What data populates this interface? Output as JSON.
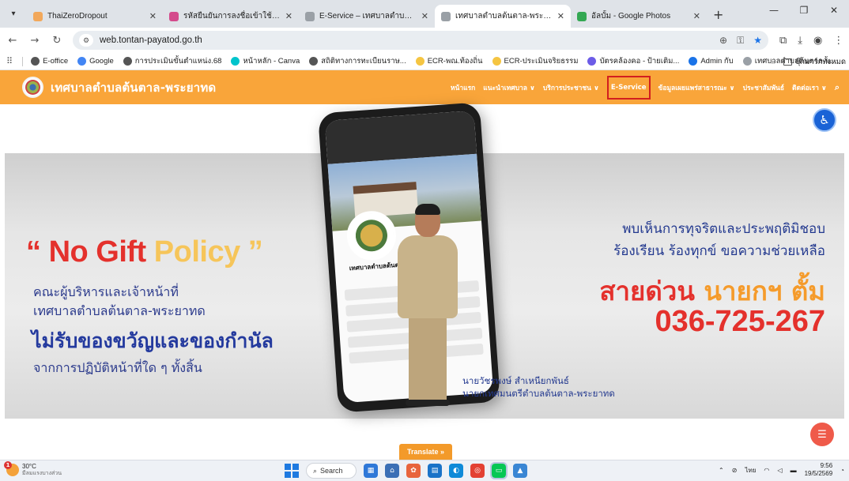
{
  "browser": {
    "tabs": [
      {
        "title": "ThaiZeroDropout",
        "color": "#f2a85b",
        "active": false
      },
      {
        "title": "รหัสยืนยันการลงชื่อเข้าใช้ระบบ Thai",
        "color": "#d44b8c",
        "active": false
      },
      {
        "title": "E-Service – เทศบาลตำบลต้นตาล-พ",
        "color": "#9aa0a6",
        "active": false
      },
      {
        "title": "เทศบาลตำบลต้นตาล-พระยาทด",
        "color": "#9aa0a6",
        "active": true
      },
      {
        "title": "อัลบั้ม - Google Photos",
        "color": "#34a853",
        "active": false
      }
    ],
    "url": "web.tontan-payatod.go.th",
    "bookmarks": [
      {
        "label": "E-office",
        "color": "#555"
      },
      {
        "label": "Google",
        "color": "#4285f4"
      },
      {
        "label": "การประเมินขั้นตำแหน่ง.68",
        "color": "#555"
      },
      {
        "label": "หน้าหลัก - Canva",
        "color": "#00c4cc"
      },
      {
        "label": "สถิติทางการทะเบียนราษ...",
        "color": "#555"
      },
      {
        "label": "ECR-พณ.ท้องถิ่น",
        "color": "#f5c542"
      },
      {
        "label": "ECR-ประเมินจริยธรรม",
        "color": "#f5c542"
      },
      {
        "label": "บัตรคล้องคอ - ป้ายเติม...",
        "color": "#6c5ce7"
      },
      {
        "label": "Admin กับ",
        "color": "#1a73e8"
      },
      {
        "label": "เทศบาลตำบลต้นตาล-พ...",
        "color": "#9aa0a6"
      }
    ],
    "bookmarks_folder": "บุ๊กมาร์กทั้งหมด"
  },
  "site": {
    "name": "เทศบาลตำบลต้นตาล-พระยาทด",
    "nav": [
      {
        "label": "หน้าแรก",
        "highlight": false
      },
      {
        "label": "แนะนำเทศบาล ∨",
        "highlight": false
      },
      {
        "label": "บริการประชาชน ∨",
        "highlight": false
      },
      {
        "label": "E-Service",
        "highlight": true
      },
      {
        "label": "ข้อมูลเผยแพร่สาธารณะ ∨",
        "highlight": false
      },
      {
        "label": "ประชาสัมพันธ์",
        "highlight": false
      },
      {
        "label": "ติดต่อเรา ∨",
        "highlight": false
      }
    ],
    "hero": {
      "policy_quote_open": "“",
      "policy_word1": "No Gift",
      "policy_word2": "Policy",
      "policy_quote_close": "”",
      "left_line1": "คณะผู้บริหารและเจ้าหน้าที่",
      "left_line2": "เทศบาลตำบลต้นตาล-พระยาทด",
      "left_big": "ไม่รับของขวัญและของกำนัล",
      "left_line3": "จากการปฏิบัติหน้าที่ใด ๆ ทั้งสิ้น",
      "right_line1": "พบเห็นการทุจริตและประพฤติมิชอบ",
      "right_line2": "ร้องเรียน ร้องทุกข์ ขอความช่วยเหลือ",
      "hotline_a": "สายด่วน",
      "hotline_b": "นายกฯ ตั้ม",
      "hotline_number": "036-725-267",
      "caption1": "นายวัชรพงษ์ สำเหนียกพันธ์",
      "caption2": "นายกเทศมนตรีตำบลต้นตาล-พระยาทด",
      "phone_page_name": "เทศบาลตำบลต้นตาล-พระยาทด"
    },
    "translate_label": "Translate »"
  },
  "taskbar": {
    "weather_temp": "30°C",
    "weather_desc": "มีลมแรงบางส่วน",
    "weather_badge": "1",
    "search_label": "Search",
    "lang": "ไทย",
    "time": "9:56",
    "date": "19/5/2569"
  }
}
